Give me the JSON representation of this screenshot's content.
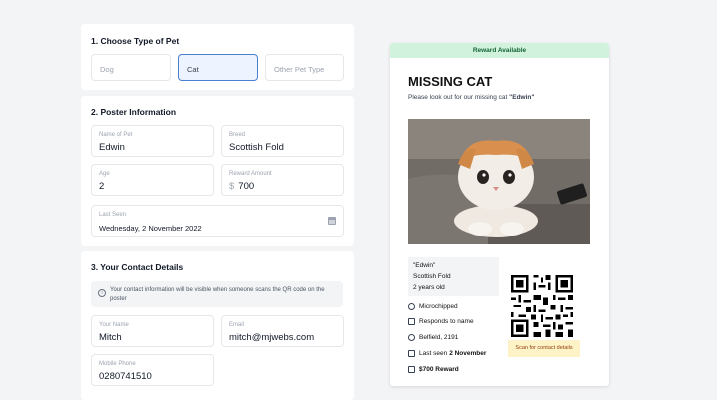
{
  "pet_type": {
    "title": "1. Choose Type of Pet",
    "options": [
      "Dog",
      "Cat",
      "Other Pet Type"
    ],
    "selected": "Cat"
  },
  "poster_info": {
    "title": "2. Poster Information",
    "name_label": "Name of Pet",
    "name_value": "Edwin",
    "breed_label": "Breed",
    "breed_value": "Scottish Fold",
    "age_label": "Age",
    "age_value": "2",
    "reward_label": "Reward Amount",
    "reward_currency": "$",
    "reward_value": "700",
    "last_seen_label": "Last Seen",
    "last_seen_value": "Wednesday, 2 November 2022"
  },
  "contact": {
    "title": "3. Your Contact Details",
    "info_text": "Your contact information will be visible when someone scans the QR code on the poster",
    "name_label": "Your Name",
    "name_value": "Mitch",
    "email_label": "Email",
    "email_value": "mitch@mjwebs.com",
    "phone_label": "Mobile Phone",
    "phone_value": "0280741510"
  },
  "poster": {
    "banner": "Reward Available",
    "title": "MISSING CAT",
    "subtitle_prefix": "Please look out for our missing cat ",
    "subtitle_name": "\"Edwin\"",
    "id_name": "\"Edwin\"",
    "id_breed": "Scottish Fold",
    "id_age": "2 years old",
    "features": {
      "microchipped": "Microchipped",
      "responds": "Responds to name",
      "location": "Belfield, 2191",
      "last_seen_prefix": "Last seen ",
      "last_seen_date": "2 November",
      "reward": "$700 Reward"
    },
    "scan_text": "Scan for contact details",
    "colors": {
      "banner_bg": "#d1f3dd",
      "banner_text": "#166534",
      "scan_bg": "#fef3c7"
    }
  }
}
